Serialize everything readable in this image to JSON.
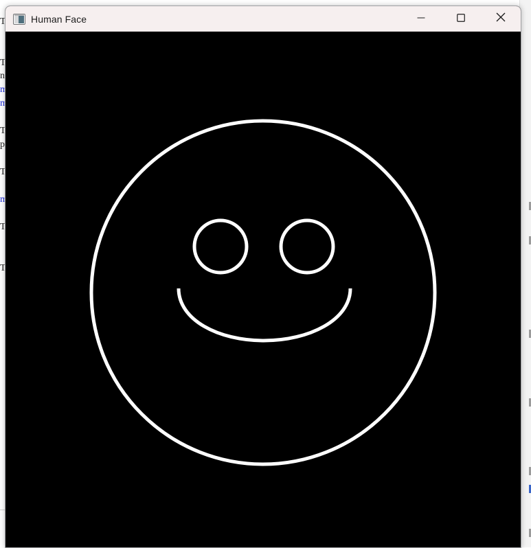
{
  "window": {
    "title": "Human Face",
    "icon": "app-window-icon",
    "controls": {
      "minimize_icon": "minimize-icon",
      "maximize_icon": "maximize-icon",
      "close_icon": "close-icon"
    }
  },
  "canvas": {
    "background": "#000000",
    "stroke": "#ffffff"
  },
  "background_app": {
    "edge_glyphs": [
      {
        "text": "T",
        "kind": "plain"
      },
      {
        "text": "T",
        "kind": "plain"
      },
      {
        "text": "n",
        "kind": "plain"
      },
      {
        "text": "m",
        "kind": "link"
      },
      {
        "text": "m",
        "kind": "link"
      },
      {
        "text": "T",
        "kind": "plain"
      },
      {
        "text": "p",
        "kind": "plain"
      },
      {
        "text": "T",
        "kind": "plain"
      },
      {
        "text": "m",
        "kind": "link"
      },
      {
        "text": "T",
        "kind": "plain"
      },
      {
        "text": "T",
        "kind": "plain"
      }
    ]
  }
}
